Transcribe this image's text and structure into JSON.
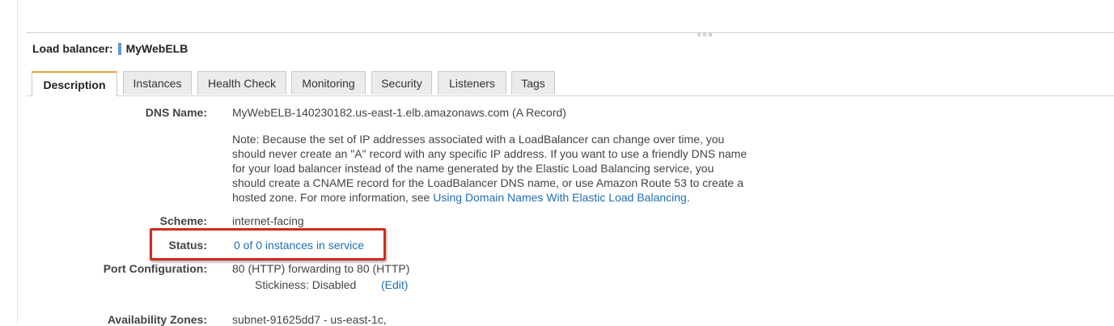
{
  "header": {
    "label": "Load balancer:",
    "name": "MyWebELB"
  },
  "tabs": [
    {
      "label": "Description",
      "active": true
    },
    {
      "label": "Instances"
    },
    {
      "label": "Health Check"
    },
    {
      "label": "Monitoring"
    },
    {
      "label": "Security"
    },
    {
      "label": "Listeners"
    },
    {
      "label": "Tags"
    }
  ],
  "details": {
    "dns": {
      "label": "DNS Name:",
      "value": "MyWebELB-140230182.us-east-1.elb.amazonaws.com (A Record)",
      "note_text": "Note: Because the set of IP addresses associated with a LoadBalancer can change over time, you should never create an \"A\" record with any specific IP address. If you want to use a friendly DNS name for your load balancer instead of the name generated by the Elastic Load Balancing service, you should create a CNAME record for the LoadBalancer DNS name, or use Amazon Route 53 to create a hosted zone. For more information, see",
      "note_link": "Using Domain Names With Elastic Load Balancing",
      "note_end": "."
    },
    "scheme": {
      "label": "Scheme:",
      "value": "internet-facing"
    },
    "status": {
      "label": "Status:",
      "value": "0 of 0 instances in service"
    },
    "port_config": {
      "label": "Port Configuration:",
      "value": "80 (HTTP) forwarding to 80 (HTTP)",
      "stickiness": "Stickiness: Disabled",
      "edit_link": "(Edit)"
    },
    "availability_zones": {
      "label": "Availability Zones:",
      "value": "subnet-91625dd7 - us-east-1c,"
    }
  },
  "colors": {
    "accent_tab": "#e8a33d",
    "link": "#1f6fb5",
    "highlight": "#d42a1e",
    "name_bar": "#5b9bd5"
  }
}
